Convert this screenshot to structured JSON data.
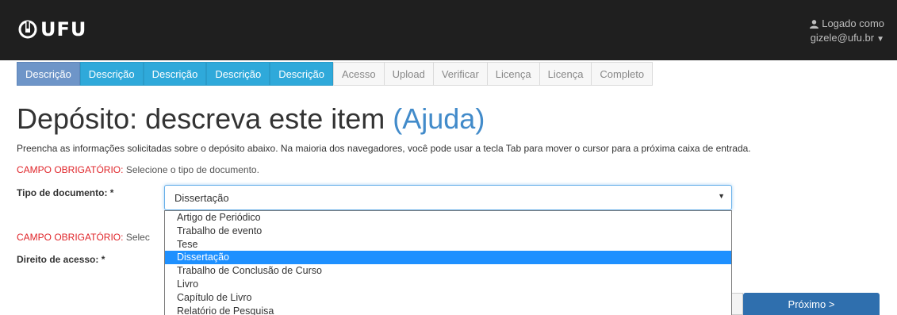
{
  "header": {
    "logo_text": "UFU",
    "logged_as_label": "Logado como",
    "user_email": "gizele@ufu.br",
    "colors": {
      "background": "#1f1f1f"
    }
  },
  "progress_tabs": [
    {
      "label": "Descrição",
      "state": "current"
    },
    {
      "label": "Descrição",
      "state": "done"
    },
    {
      "label": "Descrição",
      "state": "done"
    },
    {
      "label": "Descrição",
      "state": "done"
    },
    {
      "label": "Descrição",
      "state": "done"
    },
    {
      "label": "Acesso",
      "state": "todo"
    },
    {
      "label": "Upload",
      "state": "todo"
    },
    {
      "label": "Verificar",
      "state": "todo"
    },
    {
      "label": "Licença",
      "state": "todo"
    },
    {
      "label": "Licença",
      "state": "todo"
    },
    {
      "label": "Completo",
      "state": "todo"
    }
  ],
  "page": {
    "title": "Depósito: descreva este item",
    "help_link": "(Ajuda)",
    "intro": "Preencha as informações solicitadas sobre o depósito abaixo. Na maioria dos navegadores, você pode usar a tecla Tab para mover o cursor para a próxima caixa de entrada."
  },
  "form": {
    "required_label": "CAMPO OBRIGATÓRIO:",
    "doc_type": {
      "required_message": "Selecione o tipo de documento.",
      "label": "Tipo de documento: *",
      "selected_value": "Dissertação",
      "options": [
        "Artigo de Periódico",
        "Trabalho de evento",
        "Tese",
        "Dissertação",
        "Trabalho de Conclusão de Curso",
        "Livro",
        "Capítulo de Livro",
        "Relatório de Pesquisa"
      ],
      "highlighted_index": 3
    },
    "access": {
      "required_message_visible": "Selec",
      "label": "Direito de acesso: *"
    }
  },
  "buttons": {
    "next": "Próximo >"
  },
  "colors": {
    "tab_current": "#6e95c8",
    "tab_done": "#2fa9da",
    "link": "#428bca",
    "required": "#e0252a",
    "option_highlight": "#1e90ff",
    "next_button": "#2f6fae"
  }
}
